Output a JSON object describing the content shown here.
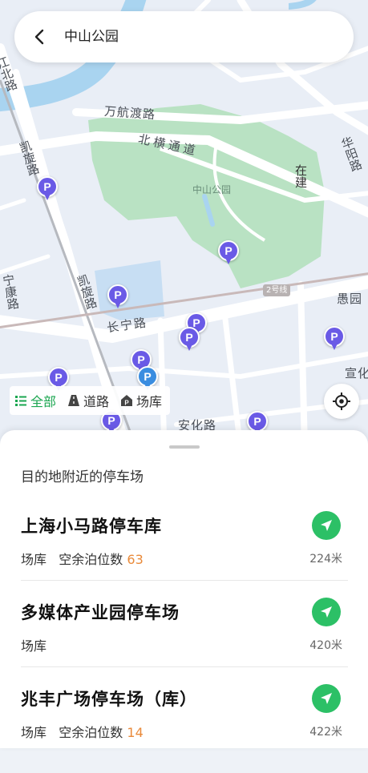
{
  "search": {
    "query": "中山公园"
  },
  "map": {
    "labels": {
      "wanhangdu": "万航渡路",
      "beiheng": "北横通道",
      "zhongshan_park": "中山公园",
      "zaijian": "在建",
      "huayang": "华阳路",
      "kaixuan_top": "凯旋路",
      "kaixuan_mid": "凯旋路",
      "ningkang": "宁康路",
      "changning": "长宁路",
      "yuyuan": "愚园",
      "xuanhua": "宣化",
      "anhua": "安化路",
      "jiang": "江北路",
      "metro_line": "2号线"
    },
    "colors": {
      "park": "#b9e2c3",
      "water": "#a9d4f0",
      "road": "#ffffff",
      "pin": "#6a5ae6"
    }
  },
  "filters": [
    {
      "label": "全部",
      "icon": "list-icon",
      "active": true
    },
    {
      "label": "道路",
      "icon": "road-icon",
      "active": false
    },
    {
      "label": "场库",
      "icon": "garage-icon",
      "active": false
    }
  ],
  "sheet": {
    "title": "目的地附近的停车场",
    "items": [
      {
        "name": "上海小马路停车库",
        "type": "场库",
        "spaces_label": "空余泊位数",
        "spaces": "63",
        "distance": "224米"
      },
      {
        "name": "多媒体产业园停车场",
        "type": "场库",
        "spaces_label": "",
        "spaces": "",
        "distance": "420米"
      },
      {
        "name": "兆丰广场停车场（库）",
        "type": "场库",
        "spaces_label": "空余泊位数",
        "spaces": "14",
        "distance": "422米"
      }
    ]
  }
}
